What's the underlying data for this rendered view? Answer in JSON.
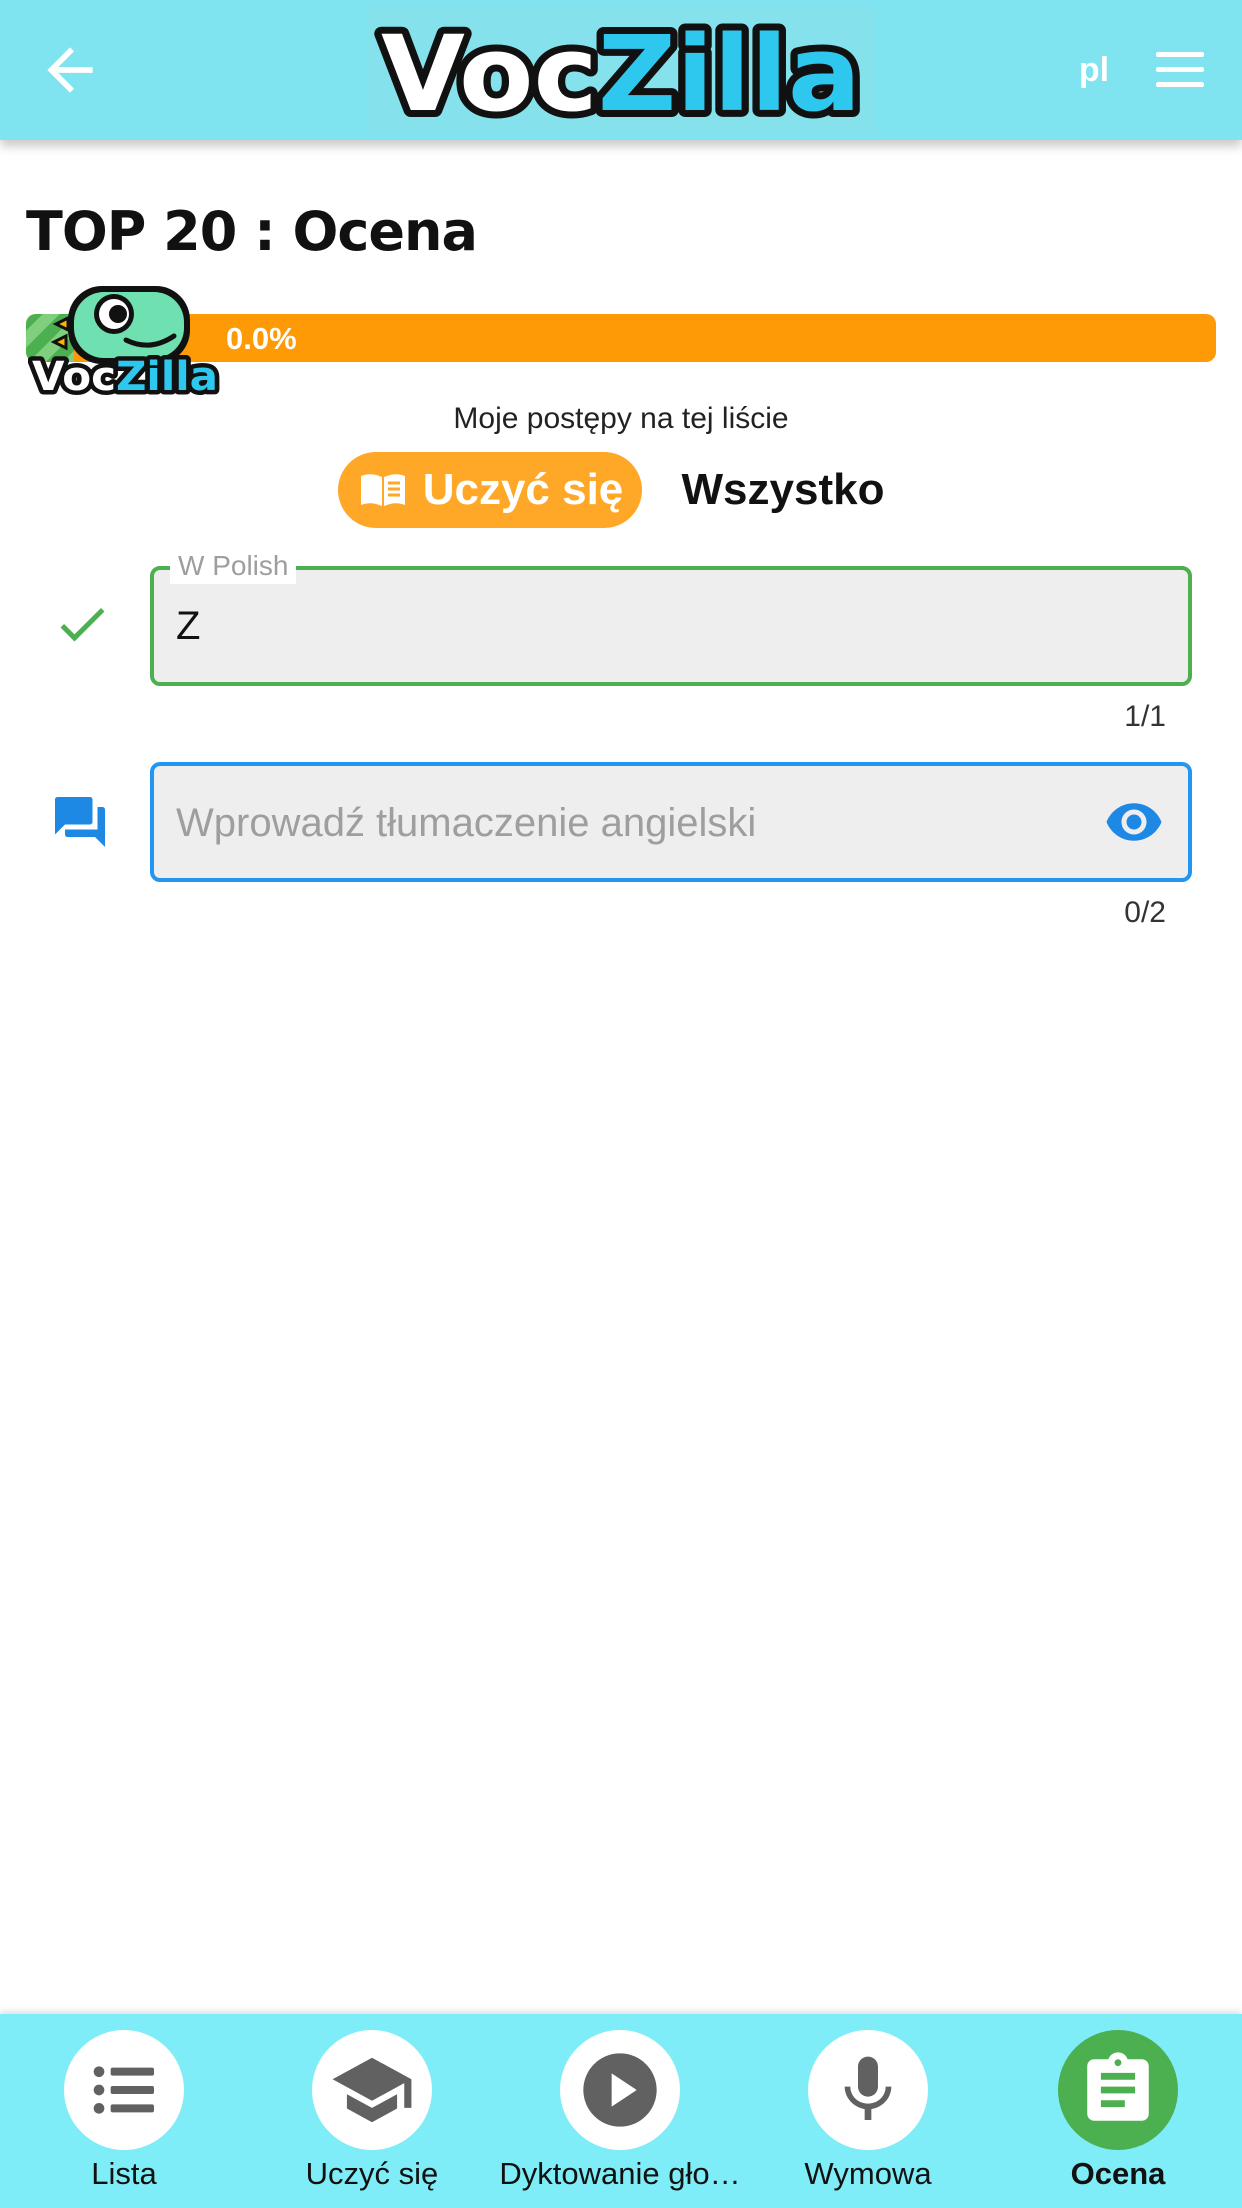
{
  "app": {
    "logo_text_dark": "Voc",
    "logo_text_light": "Zilla",
    "language": "pl",
    "colors": {
      "bar": "#7fe4f0",
      "accent": "#ffa726",
      "success": "#4caf50",
      "focus": "#2196f3"
    }
  },
  "header": {
    "back_icon": "arrow-left-icon",
    "menu_icon": "hamburger-menu-icon"
  },
  "page": {
    "title": "TOP 20 : Ocena",
    "progress": {
      "percent_text": "0.0%",
      "value": 0.0
    },
    "mascot_logo_dark": "Voc",
    "mascot_logo_light": "Zilla",
    "progress_caption": "Moje postępy na tej liście",
    "modes": {
      "learn": "Uczyć się",
      "all": "Wszystko",
      "selected": "learn"
    }
  },
  "source_field": {
    "label": "W Polish",
    "value": "Z",
    "counter": "1/1",
    "status_icon": "checkmark-icon"
  },
  "answer_field": {
    "placeholder": "Wprowadź tłumaczenie angielski",
    "value": "",
    "counter": "0/2",
    "status_icon": "chat-bubbles-icon",
    "reveal_icon": "eye-icon"
  },
  "bottom_nav": {
    "items": [
      {
        "label": "Lista",
        "icon": "list-icon",
        "active": false
      },
      {
        "label": "Uczyć się",
        "icon": "graduation-cap-icon",
        "active": false
      },
      {
        "label": "Dyktowanie gło…",
        "icon": "play-icon",
        "active": false
      },
      {
        "label": "Wymowa",
        "icon": "microphone-icon",
        "active": false
      },
      {
        "label": "Ocena",
        "icon": "clipboard-icon",
        "active": true
      }
    ]
  }
}
